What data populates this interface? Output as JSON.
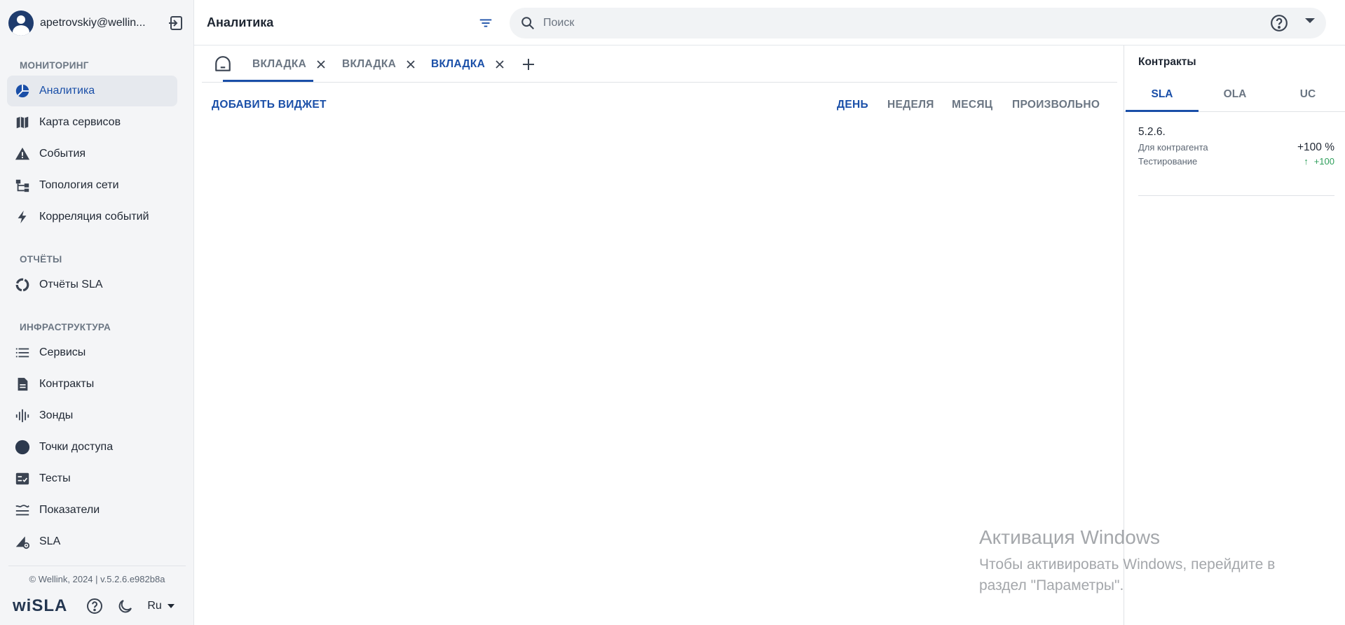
{
  "user": {
    "email": "apetrovskiy@wellin..."
  },
  "sidebar": {
    "sections": [
      {
        "title": "МОНИТОРИНГ"
      },
      {
        "title": "ОТЧЁТЫ"
      },
      {
        "title": "ИНФРАСТРУКТУРА"
      }
    ],
    "items": [
      {
        "label": "Аналитика",
        "icon": "pie-chart-icon"
      },
      {
        "label": "Карта сервисов",
        "icon": "map-icon"
      },
      {
        "label": "События",
        "icon": "warning-icon"
      },
      {
        "label": "Топология сети",
        "icon": "topology-icon"
      },
      {
        "label": "Корреляция событий",
        "icon": "lightning-icon"
      },
      {
        "label": "Отчёты SLA",
        "icon": "ring-icon"
      },
      {
        "label": "Сервисы",
        "icon": "list-icon"
      },
      {
        "label": "Контракты",
        "icon": "document-icon"
      },
      {
        "label": "Зонды",
        "icon": "probe-bars-icon"
      },
      {
        "label": "Точки доступа",
        "icon": "circle-icon"
      },
      {
        "label": "Тесты",
        "icon": "checklist-icon"
      },
      {
        "label": "Показатели",
        "icon": "waves-icon"
      },
      {
        "label": "SLA",
        "icon": "sla-gear-icon"
      }
    ],
    "footer": {
      "copyright": "© Wellink, 2024 | v.5.2.6.e982b8a",
      "brand": "wiSLA",
      "lang": "Ru"
    }
  },
  "topbar": {
    "title": "Аналитика",
    "search_placeholder": "Поиск"
  },
  "tabs": [
    {
      "label": "ВКЛАДКА",
      "active": false
    },
    {
      "label": "ВКЛАДКА",
      "active": false
    },
    {
      "label": "ВКЛАДКА",
      "active": true
    }
  ],
  "toolbar": {
    "add_widget": "ДОБАВИТЬ ВИДЖЕТ",
    "periods": [
      {
        "label": "ДЕНЬ",
        "active": true
      },
      {
        "label": "НЕДЕЛЯ",
        "active": false
      },
      {
        "label": "МЕСЯЦ",
        "active": false
      },
      {
        "label": "ПРОИЗВОЛЬНО",
        "active": false
      }
    ]
  },
  "right_panel": {
    "title": "Контракты",
    "tabs": [
      {
        "label": "SLA",
        "active": true
      },
      {
        "label": "OLA",
        "active": false
      },
      {
        "label": "UC",
        "active": false
      }
    ],
    "contracts": [
      {
        "version": "5.2.6.",
        "line1": "Для контрагента",
        "line2": "Тестирование",
        "value": "+100 %",
        "delta": "+100"
      }
    ]
  },
  "watermark": {
    "title": "Активация Windows",
    "text": "Чтобы активировать Windows, перейдите в раздел \"Параметры\"."
  },
  "colors": {
    "accent": "#1a4fa8",
    "positive": "#2e9e5b",
    "sidebar_bg": "#f4f5f7"
  }
}
